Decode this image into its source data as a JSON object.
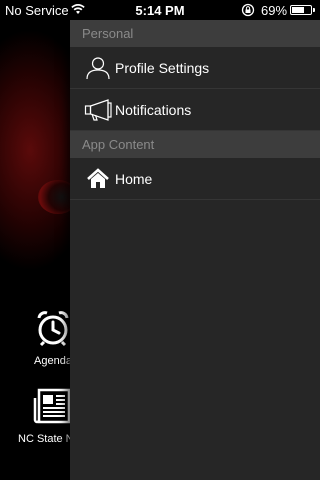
{
  "status_bar": {
    "carrier": "No Service",
    "time": "5:14 PM",
    "battery_percent": "69%",
    "battery_level": 0.69
  },
  "background_app": {
    "items": [
      {
        "label": "Agenda",
        "icon": "alarm-clock-icon"
      },
      {
        "label": "NC State News",
        "icon": "newspaper-icon"
      }
    ]
  },
  "side_menu": {
    "sections": [
      {
        "header": "Personal",
        "items": [
          {
            "label": "Profile Settings",
            "icon": "user-outline-icon"
          },
          {
            "label": "Notifications",
            "icon": "megaphone-icon"
          }
        ]
      },
      {
        "header": "App Content",
        "items": [
          {
            "label": "Home",
            "icon": "home-icon"
          }
        ]
      }
    ],
    "colors": {
      "panel_background": "#262626",
      "section_header_background": "#3d3d3d",
      "section_header_text": "#8a8a8a",
      "item_text": "#ffffff"
    }
  }
}
